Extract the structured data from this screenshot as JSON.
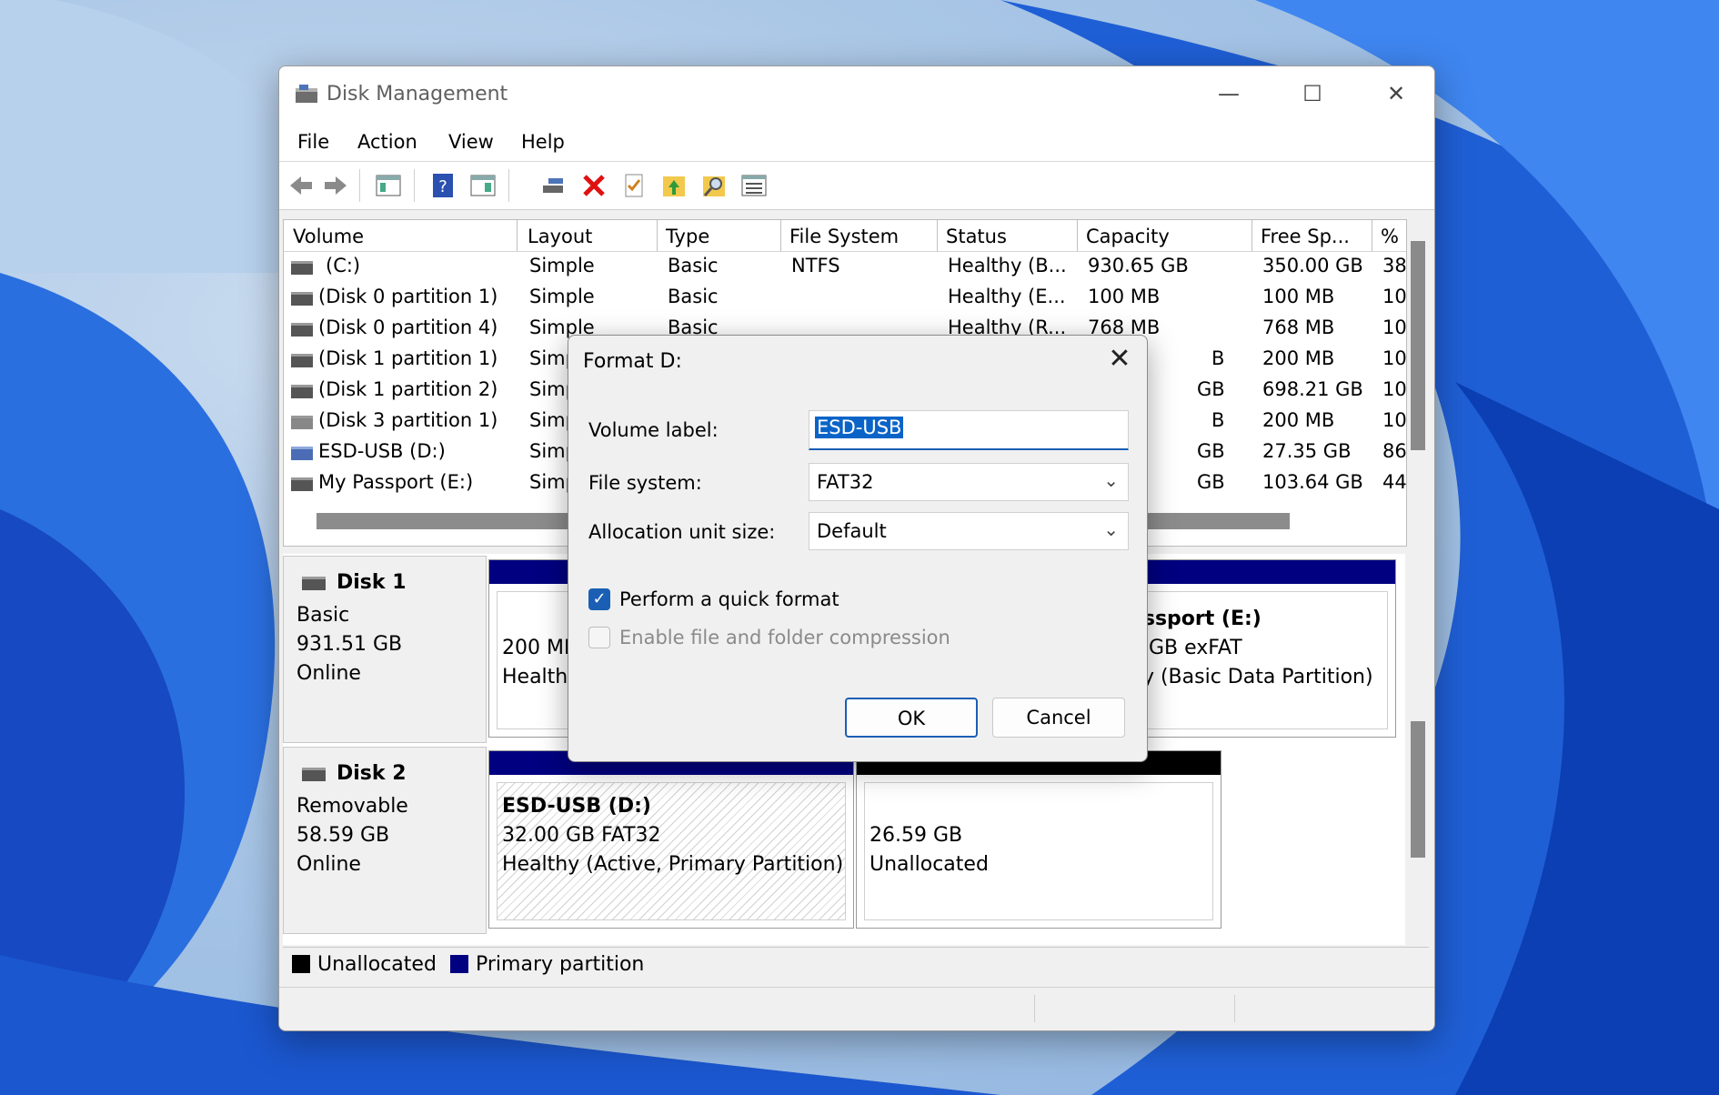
{
  "window": {
    "title": "Disk Management"
  },
  "menu": [
    "File",
    "Action",
    "View",
    "Help"
  ],
  "volumes": {
    "headers": [
      "Volume",
      "Layout",
      "Type",
      "File System",
      "Status",
      "Capacity",
      "Free Sp...",
      "%"
    ],
    "rows": [
      {
        "volume": "(C:)",
        "layout": "Simple",
        "type": "Basic",
        "fs": "NTFS",
        "status": "Healthy (B...",
        "capacity": "930.65 GB",
        "free": "350.00 GB",
        "pct": "38"
      },
      {
        "volume": "(Disk 0 partition 1)",
        "layout": "Simple",
        "type": "Basic",
        "fs": "",
        "status": "Healthy (E...",
        "capacity": "100 MB",
        "free": "100 MB",
        "pct": "10"
      },
      {
        "volume": "(Disk 0 partition 4)",
        "layout": "Simple",
        "type": "Basic",
        "fs": "",
        "status": "Healthy (R...",
        "capacity": "768 MB",
        "free": "768 MB",
        "pct": "10"
      },
      {
        "volume": "(Disk 1 partition 1)",
        "layout": "Simp",
        "type": "",
        "fs": "",
        "status": "",
        "capacity": "B",
        "free": "200 MB",
        "pct": "10"
      },
      {
        "volume": "(Disk 1 partition 2)",
        "layout": "Simp",
        "type": "",
        "fs": "",
        "status": "",
        "capacity": "GB",
        "free": "698.21 GB",
        "pct": "10"
      },
      {
        "volume": "(Disk 3 partition 1)",
        "layout": "Simp",
        "type": "",
        "fs": "",
        "status": "",
        "capacity": "B",
        "free": "200 MB",
        "pct": "10"
      },
      {
        "volume": "ESD-USB (D:)",
        "layout": "Simp",
        "type": "",
        "fs": "",
        "status": "",
        "capacity": "GB",
        "free": "27.35 GB",
        "pct": "86"
      },
      {
        "volume": "My Passport (E:)",
        "layout": "Simp",
        "type": "",
        "fs": "",
        "status": "",
        "capacity": "GB",
        "free": "103.64 GB",
        "pct": "44"
      }
    ]
  },
  "disks": {
    "disk1": {
      "name": "Disk 1",
      "kind": "Basic",
      "size": "931.51 GB",
      "state": "Online",
      "p1": {
        "l1": "200 MB",
        "l2": "Healthy"
      },
      "p2": {
        "name": "assport  (E:)",
        "l1": "8 GB exFAT",
        "l2": "hy (Basic Data Partition)"
      }
    },
    "disk2": {
      "name": "Disk 2",
      "kind": "Removable",
      "size": "58.59 GB",
      "state": "Online",
      "p1": {
        "name": "ESD-USB  (D:)",
        "l1": "32.00 GB FAT32",
        "l2": "Healthy (Active, Primary Partition)"
      },
      "p2": {
        "l1": "26.59 GB",
        "l2": "Unallocated"
      }
    }
  },
  "legend": {
    "unallocated": "Unallocated",
    "primary": "Primary partition"
  },
  "dialog": {
    "title": "Format D:",
    "volume_label": "Volume label:",
    "volume_value": "ESD-USB",
    "fs_label": "File system:",
    "fs_value": "FAT32",
    "alloc_label": "Allocation unit size:",
    "alloc_value": "Default",
    "quick_format": "Perform a quick format",
    "quick_format_checked": true,
    "compression": "Enable file and folder compression",
    "compression_checked": false,
    "ok": "OK",
    "cancel": "Cancel"
  },
  "colors": {
    "primary_partition": "#000080",
    "unallocated": "#000000",
    "accent": "#1a5fb4"
  }
}
